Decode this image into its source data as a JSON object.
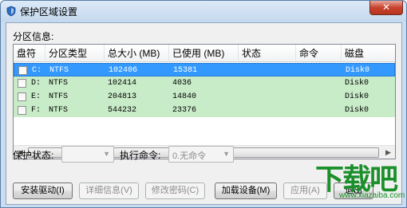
{
  "window": {
    "title": "保护区域设置",
    "close_label": "✕"
  },
  "partition_section": {
    "label": "分区信息:"
  },
  "table": {
    "columns": [
      "盘符",
      "分区类型",
      "总大小 (MB)",
      "已使用 (MB)",
      "状态",
      "命令",
      "磁盘"
    ],
    "rows": [
      {
        "drive": "C:",
        "type": "NTFS",
        "total": "102406",
        "used": "15381",
        "status": "",
        "command": "",
        "disk": "Disk0",
        "selected": true
      },
      {
        "drive": "D:",
        "type": "NTFS",
        "total": "102414",
        "used": "4036",
        "status": "",
        "command": "",
        "disk": "Disk0",
        "selected": false
      },
      {
        "drive": "E:",
        "type": "NTFS",
        "total": "204813",
        "used": "14840",
        "status": "",
        "command": "",
        "disk": "Disk0",
        "selected": false
      },
      {
        "drive": "F:",
        "type": "NTFS",
        "total": "544232",
        "used": "23376",
        "status": "",
        "command": "",
        "disk": "Disk0",
        "selected": false
      }
    ]
  },
  "controls": {
    "protect_status_label": "保护状态:",
    "protect_status_value": "",
    "exec_command_label": "执行命令:",
    "exec_command_value": "0.无命令"
  },
  "buttons": {
    "install_driver": "安装驱动(I)",
    "details": "详细信息(V)",
    "change_password": "修改密码(C)",
    "load_device": "加载设备(M)",
    "apply": "应用(A)",
    "exit": "退出"
  },
  "watermark": {
    "logo": "下载吧",
    "url": "www.xiazaiba.com"
  },
  "colors": {
    "selected_row": "#3399ff",
    "row_background": "#c8ecc8",
    "titlebar": "#c9dcf0",
    "watermark": "#1a8f2a"
  }
}
